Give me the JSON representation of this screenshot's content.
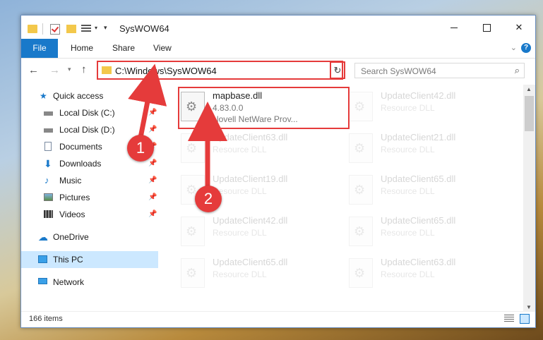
{
  "window": {
    "title": "SysWOW64"
  },
  "ribbon": {
    "tabs": [
      "File",
      "Home",
      "Share",
      "View"
    ]
  },
  "address": {
    "path": "C:\\Windows\\SysWOW64"
  },
  "search": {
    "placeholder": "Search SysWOW64"
  },
  "nav": {
    "items": [
      {
        "label": "Quick access",
        "icon": "star-icon"
      },
      {
        "label": "Local Disk (C:)",
        "icon": "drive-icon",
        "pinned": true
      },
      {
        "label": "Local Disk (D:)",
        "icon": "drive-icon",
        "pinned": true
      },
      {
        "label": "Documents",
        "icon": "documents-icon",
        "pinned": true
      },
      {
        "label": "Downloads",
        "icon": "download-icon",
        "pinned": true
      },
      {
        "label": "Music",
        "icon": "music-icon",
        "pinned": true
      },
      {
        "label": "Pictures",
        "icon": "pictures-icon",
        "pinned": true
      },
      {
        "label": "Videos",
        "icon": "videos-icon",
        "pinned": true
      },
      {
        "label": "OneDrive",
        "icon": "cloud-icon"
      },
      {
        "label": "This PC",
        "icon": "computer-icon",
        "selected": true
      },
      {
        "label": "Network",
        "icon": "network-icon"
      }
    ]
  },
  "files": [
    {
      "name": "mapbase.dll",
      "line2": "4.83.0.0",
      "line3": "Novell NetWare Prov..."
    },
    {
      "name": "UpdateClient42.dll",
      "line2": "Resource DLL"
    },
    {
      "name": "UpdateClient63.dll",
      "line2": "Resource DLL"
    },
    {
      "name": "UpdateClient21.dll",
      "line2": "Resource DLL"
    },
    {
      "name": "UpdateClient19.dll",
      "line2": "Resource DLL"
    },
    {
      "name": "UpdateClient65.dll",
      "line2": "Resource DLL"
    },
    {
      "name": "UpdateClient42.dll",
      "line2": "Resource DLL"
    },
    {
      "name": "UpdateClient65.dll",
      "line2": "Resource DLL"
    },
    {
      "name": "UpdateClient65.dll",
      "line2": "Resource DLL"
    },
    {
      "name": "UpdateClient63.dll",
      "line2": "Resource DLL"
    }
  ],
  "status": {
    "items": "166 items"
  },
  "annotations": {
    "step1": "1",
    "step2": "2"
  },
  "colors": {
    "accent": "#1979ca",
    "highlight": "#e53b3b",
    "selected": "#cce8ff"
  }
}
